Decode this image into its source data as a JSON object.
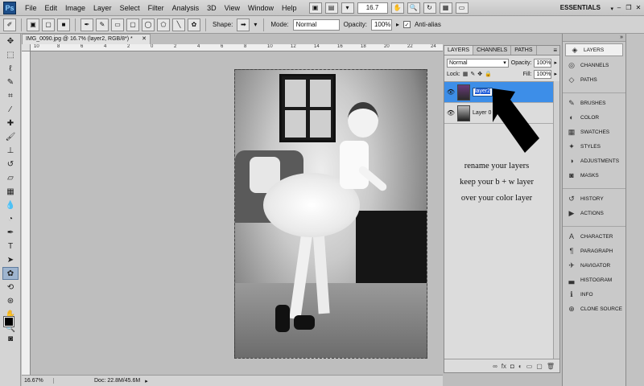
{
  "menubar": {
    "logo": "Ps",
    "items": [
      "File",
      "Edit",
      "Image",
      "Layer",
      "Select",
      "Filter",
      "Analysis",
      "3D",
      "View",
      "Window",
      "Help"
    ],
    "zoom": "16.7",
    "workspace": "ESSENTIALS"
  },
  "options": {
    "shape_label": "Shape:",
    "mode_label": "Mode:",
    "mode_value": "Normal",
    "opacity_label": "Opacity:",
    "opacity_value": "100%",
    "antialias_label": "Anti-alias"
  },
  "document": {
    "tab_title": "IMG_0090.jpg @ 16.7% (layer2, RGB/8*) *",
    "ruler_ticks": [
      "10",
      "8",
      "6",
      "4",
      "2",
      "0",
      "2",
      "4",
      "6",
      "8",
      "10",
      "12",
      "14",
      "16",
      "18",
      "20",
      "22",
      "24"
    ],
    "status_zoom": "16.67%",
    "status_doc": "Doc: 22.8M/45.6M"
  },
  "layers_panel": {
    "tabs": [
      "LAYERS",
      "CHANNELS",
      "PATHS"
    ],
    "blend_mode": "Normal",
    "opacity_label": "Opacity:",
    "opacity_value": "100%",
    "lock_label": "Lock:",
    "fill_label": "Fill:",
    "fill_value": "100%",
    "layers": [
      {
        "name": "layer2",
        "selected": true,
        "editing": true
      },
      {
        "name": "Layer 0",
        "selected": false,
        "editing": false
      }
    ]
  },
  "annotation": {
    "lines": [
      "rename your layers",
      "keep your b + w layer",
      "over your color layer"
    ]
  },
  "dock": {
    "items": [
      {
        "label": "LAYERS",
        "icon": "layers-icon",
        "active": true
      },
      {
        "label": "CHANNELS",
        "icon": "channels-icon"
      },
      {
        "label": "PATHS",
        "icon": "paths-icon"
      },
      {
        "sep": true
      },
      {
        "label": "BRUSHES",
        "icon": "brush-icon"
      },
      {
        "label": "COLOR",
        "icon": "color-icon"
      },
      {
        "label": "SWATCHES",
        "icon": "swatches-icon"
      },
      {
        "label": "STYLES",
        "icon": "styles-icon"
      },
      {
        "label": "ADJUSTMENTS",
        "icon": "adjustments-icon"
      },
      {
        "label": "MASKS",
        "icon": "masks-icon"
      },
      {
        "sep": true
      },
      {
        "label": "HISTORY",
        "icon": "history-icon"
      },
      {
        "label": "ACTIONS",
        "icon": "actions-icon"
      },
      {
        "sep": true
      },
      {
        "label": "CHARACTER",
        "icon": "character-icon"
      },
      {
        "label": "PARAGRAPH",
        "icon": "paragraph-icon"
      },
      {
        "label": "NAVIGATOR",
        "icon": "navigator-icon"
      },
      {
        "label": "HISTOGRAM",
        "icon": "histogram-icon"
      },
      {
        "label": "INFO",
        "icon": "info-icon"
      },
      {
        "label": "CLONE SOURCE",
        "icon": "clone-source-icon"
      }
    ]
  }
}
